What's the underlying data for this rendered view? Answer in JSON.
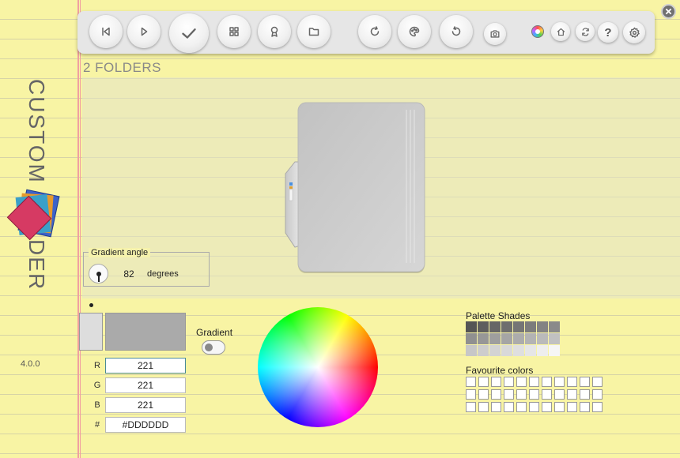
{
  "app": {
    "vertical_title": "CUSTOM FOLDER",
    "version": "4.0.0"
  },
  "toolbar": {
    "buttons": [
      {
        "name": "previous-button",
        "icon": "skip-back-icon"
      },
      {
        "name": "play-button",
        "icon": "play-icon"
      },
      {
        "name": "apply-button",
        "icon": "check-icon"
      },
      {
        "name": "grid-button",
        "icon": "grid-icon"
      },
      {
        "name": "badge-button",
        "icon": "award-icon"
      },
      {
        "name": "folder-button",
        "icon": "folder-icon"
      },
      {
        "name": "refresh-button",
        "icon": "refresh-icon"
      },
      {
        "name": "palette-button",
        "icon": "palette-icon"
      },
      {
        "name": "undo-button",
        "icon": "undo-icon"
      },
      {
        "name": "screenshot-button",
        "icon": "camera-icon"
      },
      {
        "name": "color-mode-button",
        "icon": "color-wheel-icon"
      },
      {
        "name": "home-button",
        "icon": "home-icon"
      },
      {
        "name": "sync-button",
        "icon": "sync-icon"
      },
      {
        "name": "help-button",
        "icon": "help-icon",
        "label": "?"
      },
      {
        "name": "settings-button",
        "icon": "gear-icon"
      }
    ]
  },
  "preview": {
    "folder_count_label": "2 FOLDERS"
  },
  "gradient_angle": {
    "title": "Gradient angle",
    "value": "82",
    "unit": "degrees"
  },
  "color": {
    "fields": [
      {
        "label": "R",
        "value": "221"
      },
      {
        "label": "G",
        "value": "221"
      },
      {
        "label": "B",
        "value": "221"
      },
      {
        "label": "#",
        "value": "#DDDDDD"
      }
    ],
    "swatch_primary": "#dddddd",
    "swatch_secondary": "#aaaaaa"
  },
  "gradient_toggle": {
    "label": "Gradient",
    "state": "off"
  },
  "palette": {
    "title": "Palette Shades",
    "rows": [
      [
        "#555555",
        "#5e5e5e",
        "#666666",
        "#6e6e6e",
        "#757575",
        "#7c7c7c",
        "#838383",
        "#8a8a8a"
      ],
      [
        "#909090",
        "#979797",
        "#9e9e9e",
        "#a5a5a5",
        "#acacac",
        "#b3b3b3",
        "#bababa",
        "#c1c1c1"
      ],
      [
        "#c7c7c7",
        "#cdcdcd",
        "#d3d3d3",
        "#d9d9d9",
        "#dfdfdf",
        "#e6e6e6",
        "#eeeeee",
        "#f6f6f6"
      ]
    ]
  },
  "favourites": {
    "title": "Favourite colors",
    "rows": 3,
    "columns": 11
  }
}
